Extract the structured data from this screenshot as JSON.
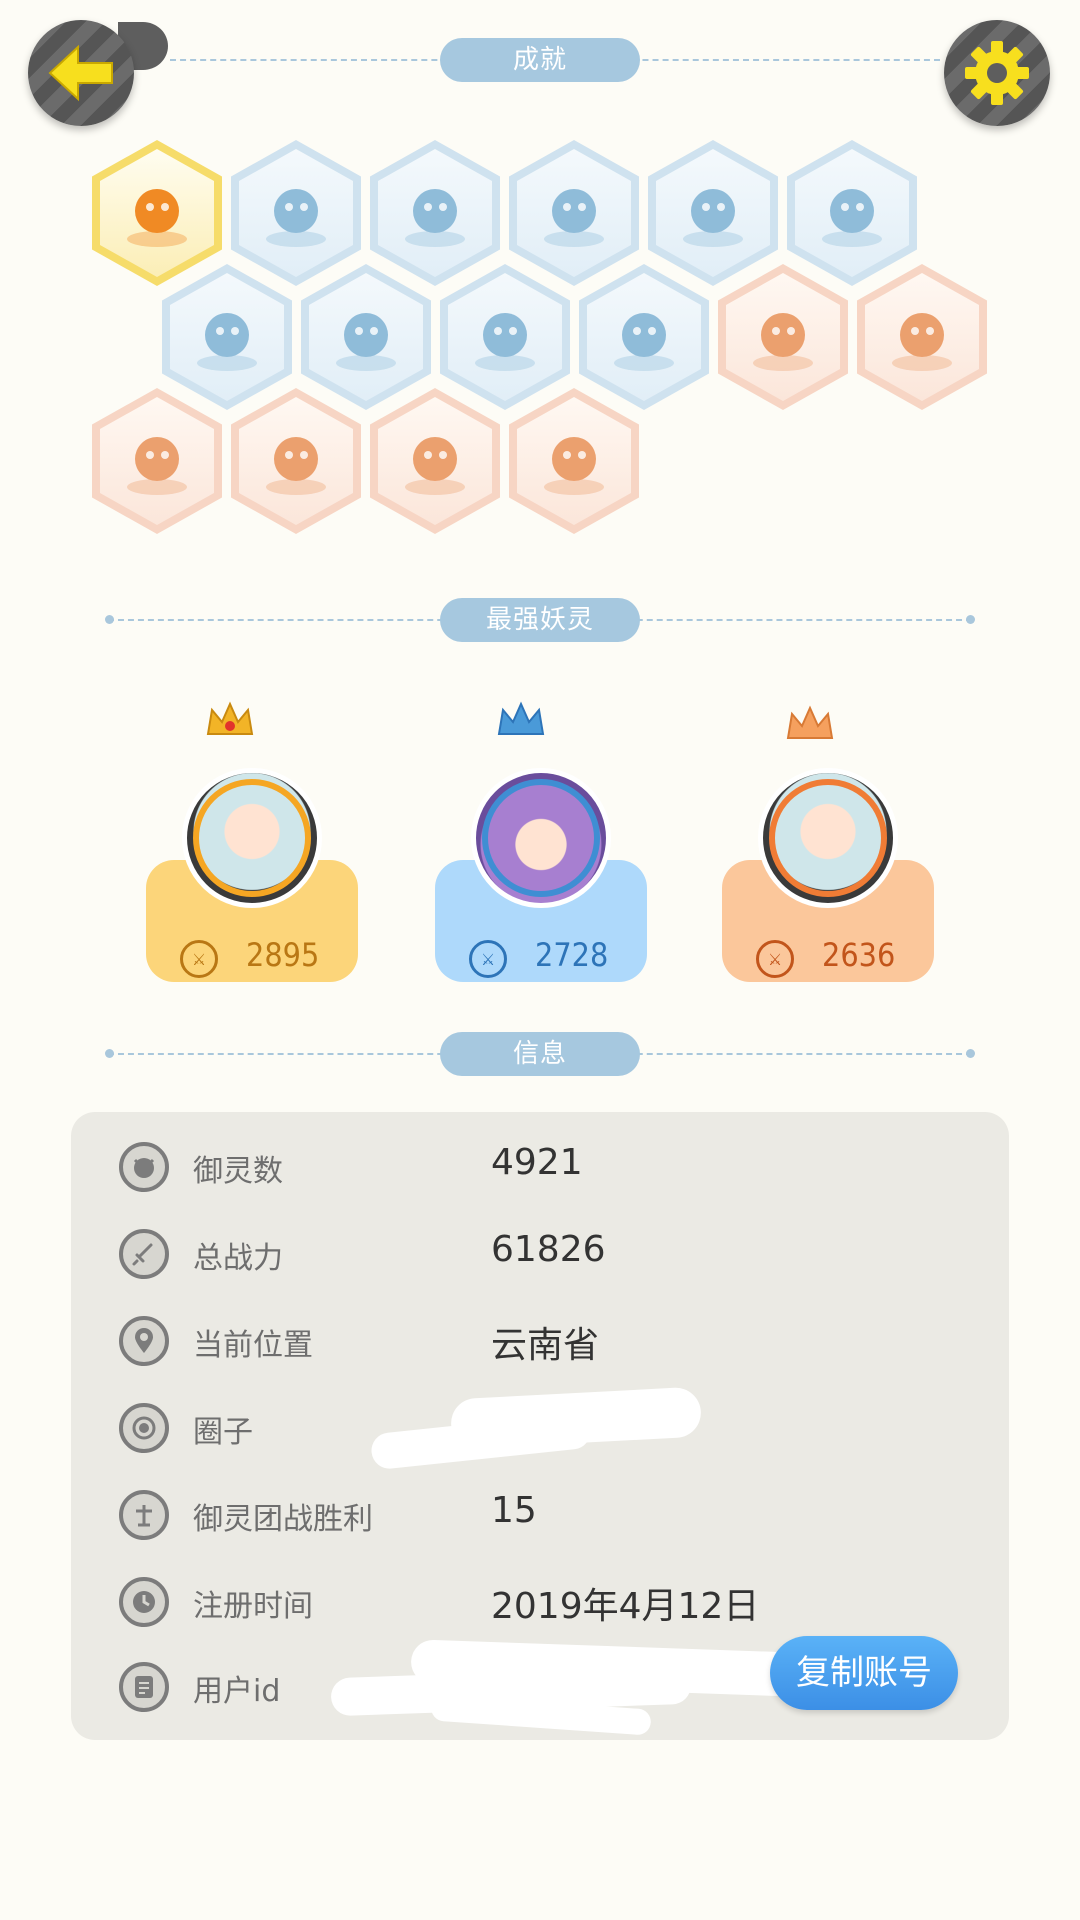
{
  "header": {
    "back_icon": "back-arrow-icon",
    "settings_icon": "gear-icon",
    "colors": {
      "button_bg": "#5e5e5e",
      "icon_yellow": "#f7df1e"
    }
  },
  "sections": {
    "achievements": "成就",
    "top_spirits": "最强妖灵",
    "info": "信息"
  },
  "achievements": [
    {
      "icon": "orange-cat-icon",
      "tier": "gold"
    },
    {
      "icon": "sneaker-icon",
      "tier": "blue"
    },
    {
      "icon": "vortex-mirror-icon",
      "tier": "blue"
    },
    {
      "icon": "moon-icon",
      "tier": "blue"
    },
    {
      "icon": "orb-icon",
      "tier": "blue"
    },
    {
      "icon": "yin-yang-swirl-icon",
      "tier": "blue"
    },
    {
      "icon": "spirit-figure-icon",
      "tier": "blue"
    },
    {
      "icon": "cat-spirit-icon",
      "tier": "blue"
    },
    {
      "icon": "yin-yang-book-icon",
      "tier": "blue"
    },
    {
      "icon": "fox-spirit-icon",
      "tier": "blue"
    },
    {
      "icon": "egg-icon",
      "tier": "orange"
    },
    {
      "icon": "cart-cat-icon",
      "tier": "orange"
    },
    {
      "icon": "koi-fish-icon",
      "tier": "orange"
    },
    {
      "icon": "shield-icon",
      "tier": "orange"
    },
    {
      "icon": "demon-statue-icon",
      "tier": "orange"
    },
    {
      "icon": "fox-book-icon",
      "tier": "orange"
    }
  ],
  "champions": [
    {
      "power": "2895",
      "rank": "gold",
      "color": "#fcd57a",
      "text_color": "#b97714"
    },
    {
      "power": "2728",
      "rank": "blue",
      "color": "#aed9fb",
      "text_color": "#2d74b8"
    },
    {
      "power": "2636",
      "rank": "orange",
      "color": "#fbc79b",
      "text_color": "#c2551b"
    }
  ],
  "info": [
    {
      "icon": "spirit-face-icon",
      "label": "御灵数",
      "value": "4921"
    },
    {
      "icon": "sword-icon",
      "label": "总战力",
      "value": "61826"
    },
    {
      "icon": "location-pin-icon",
      "label": "当前位置",
      "value": "云南省"
    },
    {
      "icon": "circle-target-icon",
      "label": "圈子",
      "value": ""
    },
    {
      "icon": "team-battle-icon",
      "label": "御灵团战胜利",
      "value": "15"
    },
    {
      "icon": "clock-icon",
      "label": "注册时间",
      "value": "2019年4月12日"
    },
    {
      "icon": "document-icon",
      "label": "用户id",
      "value": ""
    }
  ],
  "copy_button": "复制账号"
}
